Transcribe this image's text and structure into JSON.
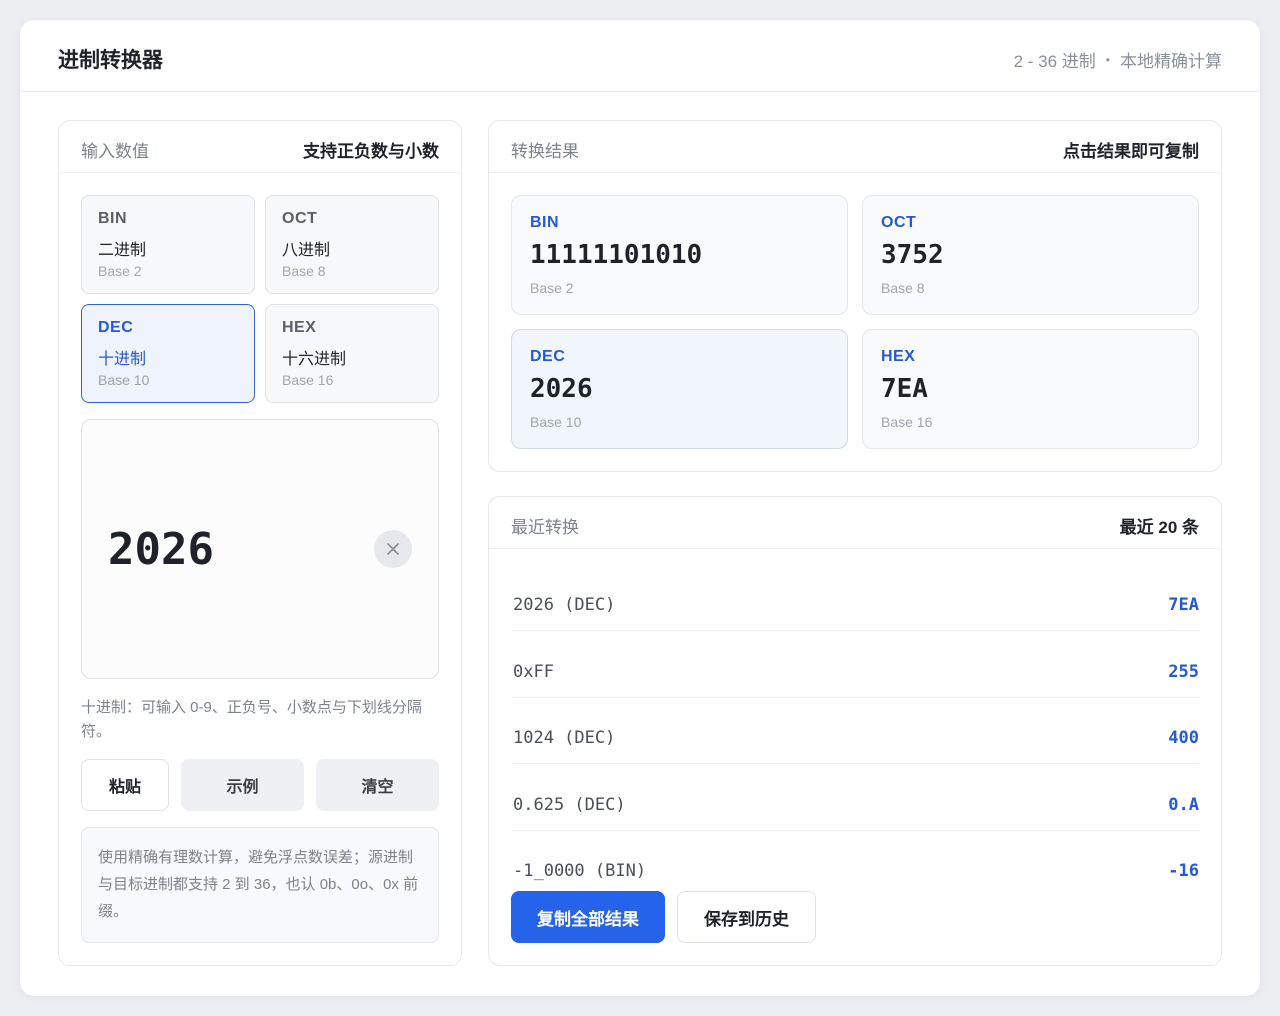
{
  "header": {
    "title": "进制转换器",
    "meta_range": "2 - 36 进制",
    "meta_sep": "•",
    "meta_mode": "本地精确计算"
  },
  "input_panel": {
    "heading": "输入数值",
    "heading_note": "支持正负数与小数",
    "bases": [
      {
        "code": "BIN",
        "name": "二进制",
        "base": "Base 2",
        "active": false
      },
      {
        "code": "OCT",
        "name": "八进制",
        "base": "Base 8",
        "active": false
      },
      {
        "code": "DEC",
        "name": "十进制",
        "base": "Base 10",
        "active": true
      },
      {
        "code": "HEX",
        "name": "十六进制",
        "base": "Base 16",
        "active": false
      }
    ],
    "value": "2026",
    "clear_icon": "close-icon",
    "hint": "十进制：可输入 0-9、正负号、小数点与下划线分隔符。",
    "buttons": {
      "paste": "粘贴",
      "sample": "示例",
      "clear": "清空"
    },
    "note": "使用精确有理数计算，避免浮点数误差；源进制与目标进制都支持 2 到 36，也认 0b、0o、0x 前缀。"
  },
  "result_panel": {
    "heading": "转换结果",
    "heading_note": "点击结果即可复制",
    "results": [
      {
        "code": "BIN",
        "value": "11111101010",
        "base": "Base 2",
        "active": false
      },
      {
        "code": "OCT",
        "value": "3752",
        "base": "Base 8",
        "active": false
      },
      {
        "code": "DEC",
        "value": "2026",
        "base": "Base 10",
        "active": true
      },
      {
        "code": "HEX",
        "value": "7EA",
        "base": "Base 16",
        "active": false
      }
    ]
  },
  "history_panel": {
    "heading": "最近转换",
    "heading_note": "最近 20 条",
    "items": [
      {
        "source": "2026 (DEC)",
        "result": "7EA"
      },
      {
        "source": "0xFF",
        "result": "255"
      },
      {
        "source": "1024 (DEC)",
        "result": "400"
      },
      {
        "source": "0.625 (DEC)",
        "result": "0.A"
      },
      {
        "source": "-1_0000 (BIN)",
        "result": "-16"
      }
    ],
    "copy_all": "复制全部结果",
    "save": "保存到历史"
  },
  "colors": {
    "accent": "#2563eb",
    "accent_text": "#2559d6",
    "active_tile_bg": "#eef3fd"
  }
}
